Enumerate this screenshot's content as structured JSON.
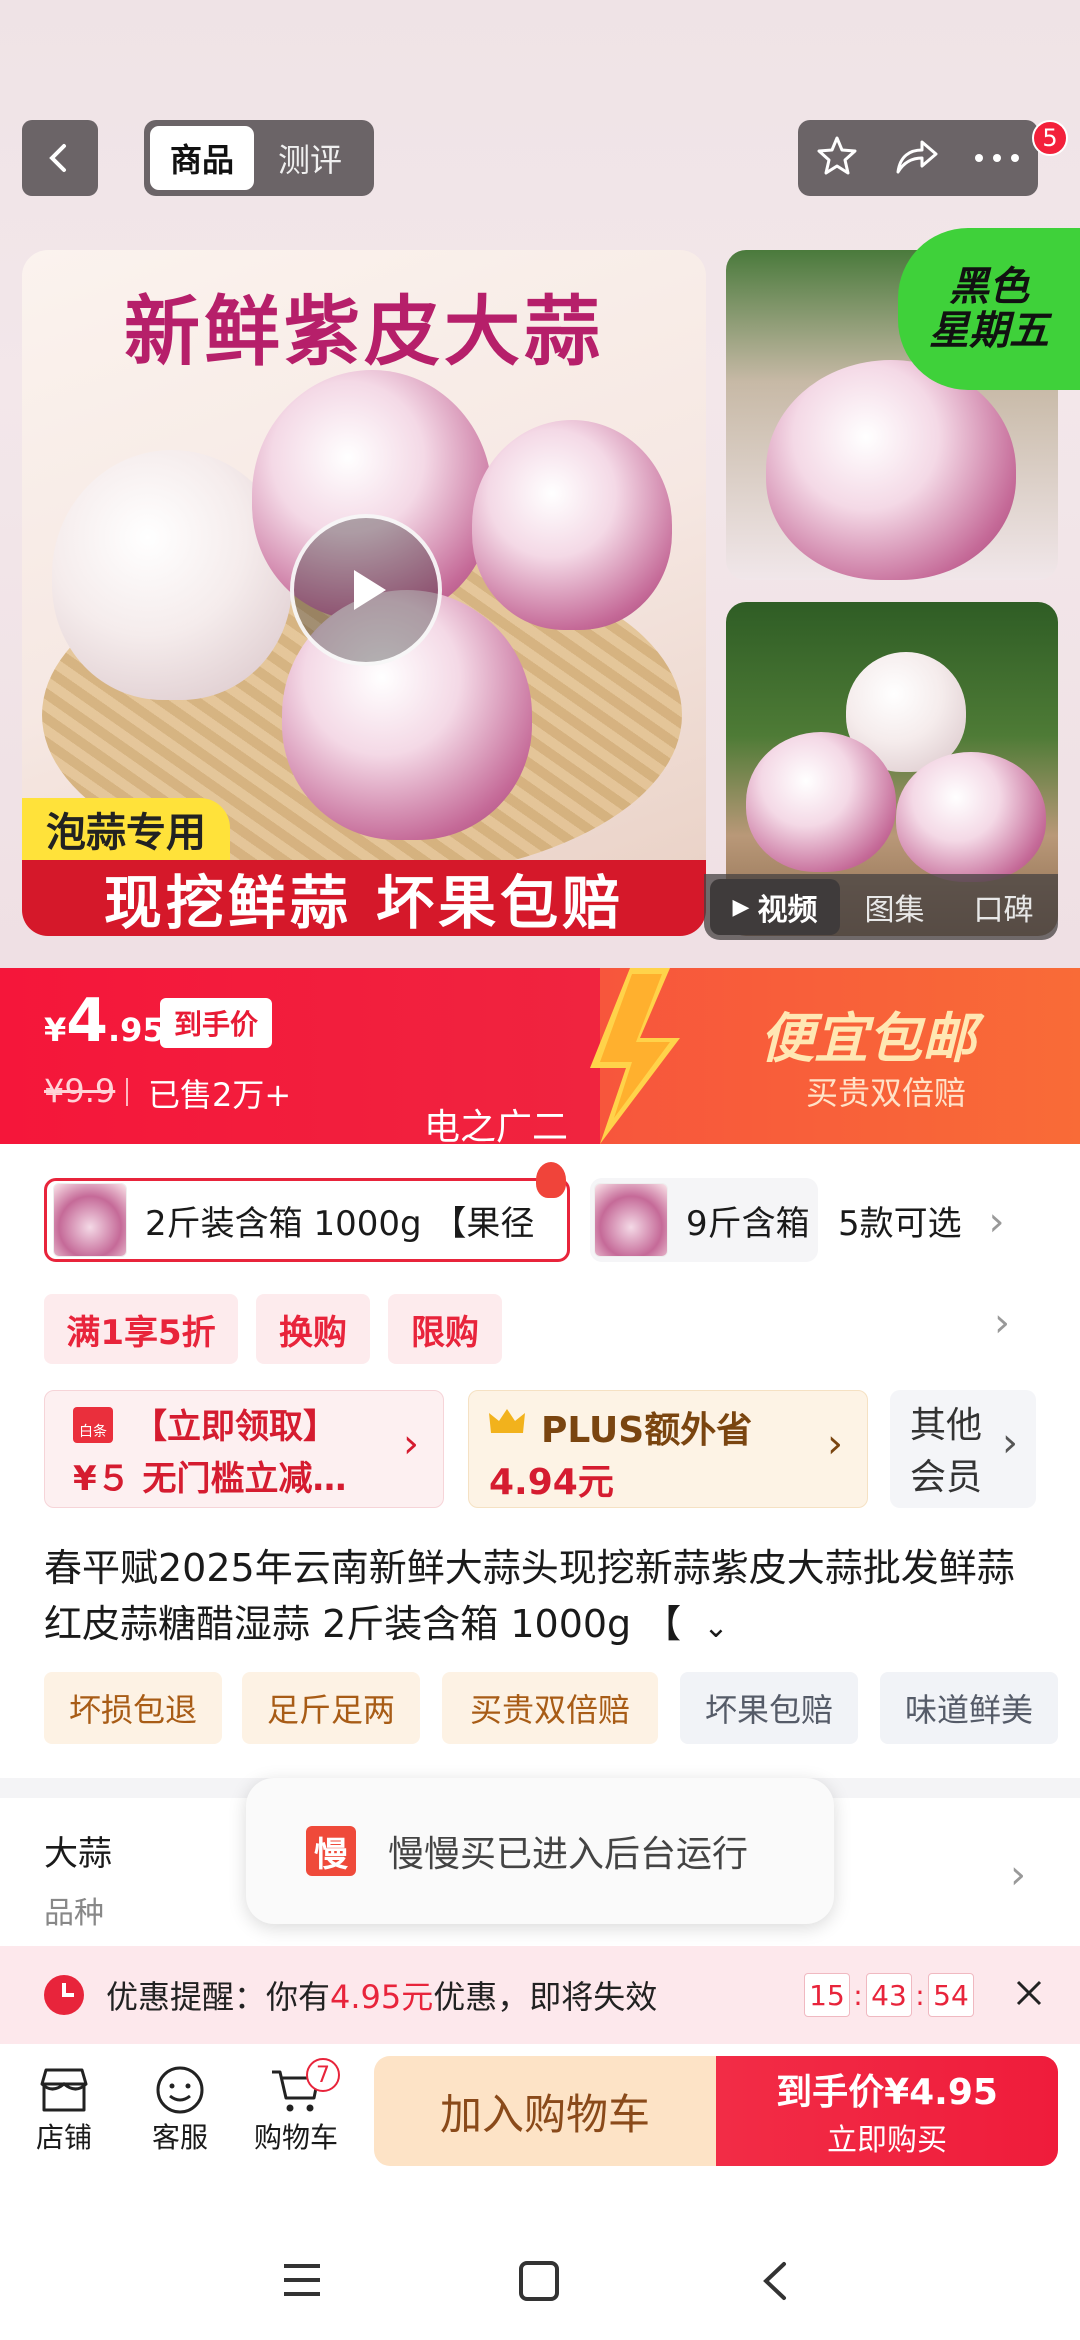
{
  "header": {
    "tabs": [
      "商品",
      "测评"
    ],
    "badge_count": "5"
  },
  "gallery": {
    "main_title": "新鲜紫皮大蒜",
    "tag_yellow": "泡蒜专用",
    "tag_red": "现挖鲜蒜 坏果包赔",
    "promo_label": "黑色\n星期五",
    "media_tabs": [
      "视频",
      "图集",
      "口碑"
    ]
  },
  "price": {
    "currency": "¥",
    "integer": "4",
    "decimal": ".95",
    "tag": "到手价",
    "original": "¥9.9",
    "sold": "已售2万+",
    "promo_title": "便宜包邮",
    "promo_sub": "买贵双倍赔",
    "overlay": "电之广二"
  },
  "sku": {
    "selected": "2斤装含箱 1000g 【果径",
    "other": "9斤含箱",
    "more": "5款可选"
  },
  "chips": [
    "满1享5折",
    "换购",
    "限购"
  ],
  "coupon": {
    "icon_text": "白条",
    "line1": "【立即领取】",
    "line2": "¥５ 无门槛立减…"
  },
  "plus": {
    "line1": "PLUS额外省",
    "line2": "4.94元"
  },
  "member": {
    "line1": "其他",
    "line2": "会员"
  },
  "product_title": "春平赋2025年云南新鲜大蒜头现挖新蒜紫皮大蒜批发鲜蒜红皮蒜糖醋湿蒜 2斤装含箱 1000g 【",
  "services": [
    "坏损包退",
    "足斤足两",
    "买贵双倍赔",
    "坏果包赔",
    "味道鲜美"
  ],
  "attribute": {
    "value": "大蒜",
    "label": "品种"
  },
  "toast": {
    "logo": "慢",
    "text": "慢慢买已进入后台运行"
  },
  "reminder": {
    "prefix": "优惠提醒：你有",
    "amount": "4.95元",
    "suffix": "优惠，即将失效",
    "hours": "15",
    "minutes": "43",
    "seconds": "54"
  },
  "bottom": {
    "shop": "店铺",
    "service": "客服",
    "cart": "购物车",
    "cart_count": "7",
    "add_cart": "加入购物车",
    "buy_price": "到手价¥4.95",
    "buy_now": "立即购买"
  },
  "colors": {
    "accent": "#e8243b",
    "price_banner": "#f5163a",
    "add_cart_bg": "#fde3c6"
  }
}
